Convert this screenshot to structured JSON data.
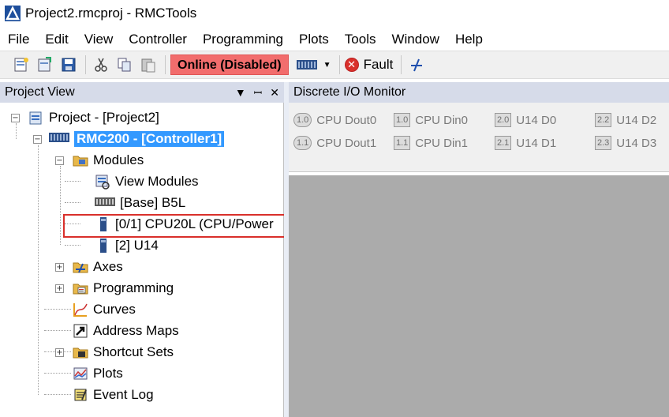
{
  "window": {
    "title": "Project2.rmcproj - RMCTools",
    "app_icon": "rmctools-logo-icon"
  },
  "menu": [
    "File",
    "Edit",
    "View",
    "Controller",
    "Programming",
    "Plots",
    "Tools",
    "Window",
    "Help"
  ],
  "toolbar": {
    "online_status": "Online (Disabled)",
    "fault_label": "Fault",
    "icons": [
      "new-project-icon",
      "open-project-icon",
      "save-icon",
      "cut-icon",
      "copy-icon",
      "paste-icon",
      "controller-icon",
      "dropdown-arrow-icon",
      "fault-icon",
      "axis-tool-icon"
    ]
  },
  "project_view": {
    "title": "Project View",
    "controls": {
      "dropdown": "▼",
      "pin": "📌",
      "close": "✕"
    },
    "tree": {
      "project": "Project - [Project2]",
      "controller": "RMC200 - [Controller1]",
      "modules": "Modules",
      "view_modules": "View Modules",
      "base": "[Base] B5L",
      "cpu": "[0/1] CPU20L (CPU/Power",
      "u14": "[2] U14",
      "axes": "Axes",
      "programming": "Programming",
      "curves": "Curves",
      "address_maps": "Address Maps",
      "shortcut_sets": "Shortcut Sets",
      "plots": "Plots",
      "event_log": "Event Log"
    }
  },
  "monitor": {
    "title": "Discrete I/O Monitor",
    "items": [
      {
        "chip": "1.0",
        "label": "CPU Dout0"
      },
      {
        "chip": "1.0",
        "label": "CPU Din0"
      },
      {
        "chip": "2.0",
        "label": "U14 D0"
      },
      {
        "chip": "2.2",
        "label": "U14 D2"
      },
      {
        "chip": "1.1",
        "label": "CPU Dout1"
      },
      {
        "chip": "1.1",
        "label": "CPU Din1"
      },
      {
        "chip": "2.1",
        "label": "U14 D1"
      },
      {
        "chip": "2.3",
        "label": "U14 D3"
      }
    ]
  },
  "colors": {
    "online_badge": "#f26d6d",
    "selection": "#3399ff",
    "panel_header": "#d6dbe9",
    "highlight_box": "#d9302b"
  }
}
